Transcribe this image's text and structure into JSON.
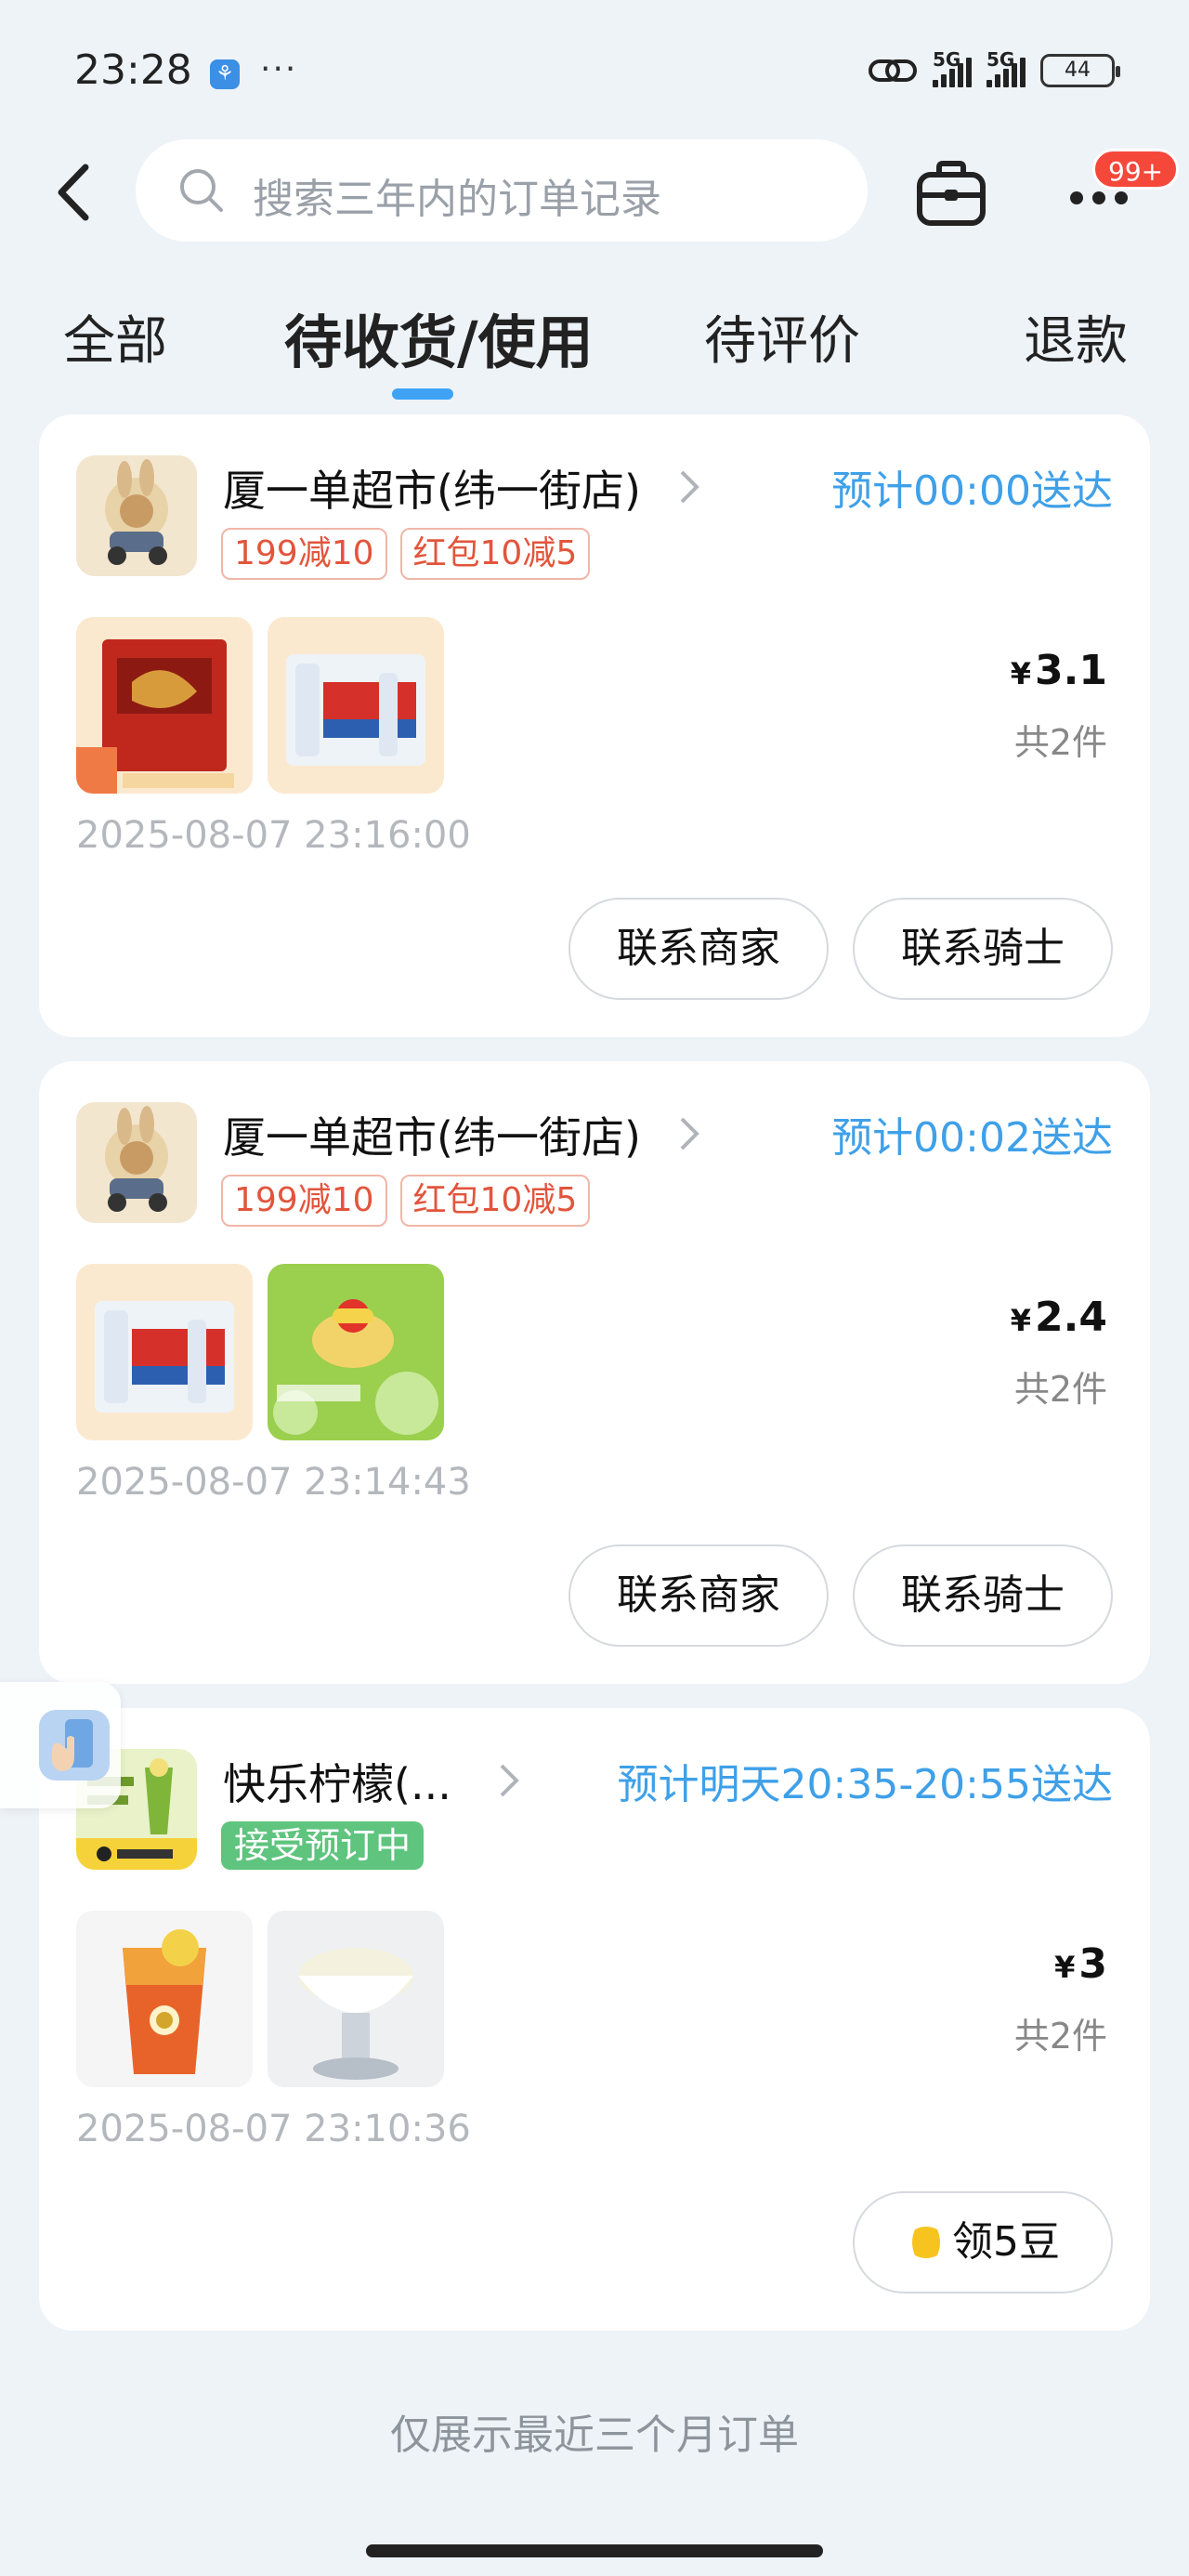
{
  "status_bar": {
    "time": "23:28",
    "network_1": "5G",
    "network_2": "5G",
    "battery": "44"
  },
  "header": {
    "search_placeholder": "搜索三年内的订单记录",
    "more_badge": "99+"
  },
  "tabs": [
    {
      "label": "全部",
      "active": false
    },
    {
      "label": "待收货/使用",
      "active": true
    },
    {
      "label": "待评价",
      "active": false
    },
    {
      "label": "退款",
      "active": false
    }
  ],
  "orders": [
    {
      "shop_name": "厦一单超市(纬一街店)",
      "delivery": "预计00:00送达",
      "tags": [
        "199减10",
        "红包10减5"
      ],
      "price_symbol": "¥",
      "price": "3.1",
      "count": "共2件",
      "time": "2025-08-07 23:16:00",
      "buttons": [
        "联系商家",
        "联系骑士"
      ]
    },
    {
      "shop_name": "厦一单超市(纬一街店)",
      "delivery": "预计00:02送达",
      "tags": [
        "199减10",
        "红包10减5"
      ],
      "price_symbol": "¥",
      "price": "2.4",
      "count": "共2件",
      "time": "2025-08-07 23:14:43",
      "buttons": [
        "联系商家",
        "联系骑士"
      ]
    },
    {
      "shop_name": "快乐柠檬(...",
      "delivery": "预计明天20:35-20:55送达",
      "status_tag": "接受预订中",
      "price_symbol": "¥",
      "price": "3",
      "count": "共2件",
      "time": "2025-08-07 23:10:36",
      "buttons": [
        "领5豆"
      ]
    }
  ],
  "footer_note": "仅展示最近三个月订单",
  "colors": {
    "accent_blue": "#3fa0e8",
    "tag_red": "#e2553c",
    "tag_green": "#5ec47e",
    "badge_red": "#f5483b",
    "background": "#eef3f8"
  }
}
